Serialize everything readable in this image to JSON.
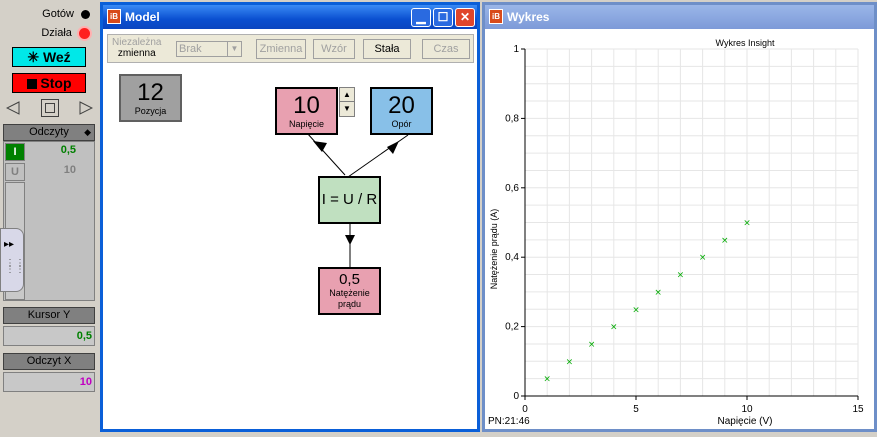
{
  "left_panel": {
    "ready_label": "Gotów",
    "working_label": "Działa",
    "take_label": "Weź",
    "stop_label": "Stop",
    "readings_header": "Odczyty",
    "readings": [
      {
        "tag": "I",
        "value": "0,5",
        "color": "#008000"
      },
      {
        "tag": "U",
        "value": "10",
        "color": "#808080"
      }
    ],
    "cursor_y_header": "Kursor Y",
    "cursor_y_value": "0,5",
    "reading_x_header": "Odczyt X",
    "reading_x_value": "10"
  },
  "model_window": {
    "title": "Model",
    "toolbar": {
      "independent_label_1": "Niezależna",
      "independent_label_2": "zmienna",
      "select_value": "Brak",
      "variable": "Zmienna",
      "formula": "Wzór",
      "constant": "Stała",
      "time": "Czas"
    },
    "nodes": {
      "position": {
        "value": "12",
        "label": "Pozycja"
      },
      "voltage": {
        "value": "10",
        "label": "Napięcie"
      },
      "resistance": {
        "value": "20",
        "label": "Opór"
      },
      "formula": {
        "value": "I = U / R"
      },
      "current": {
        "value": "0,5",
        "label1": "Natężenie",
        "label2": "prądu"
      }
    }
  },
  "chart_window": {
    "title": "Wykres",
    "status": "PN:21:46"
  },
  "chart_data": {
    "type": "scatter",
    "title": "Wykres Insight",
    "xlabel": "Napięcie (V)",
    "ylabel": "Natężenie prądu (A)",
    "xlim": [
      0,
      15
    ],
    "ylim": [
      0,
      1
    ],
    "xticks": [
      "0",
      "5",
      "10",
      "15"
    ],
    "yticks": [
      "0",
      "0,2",
      "0,4",
      "0,6",
      "0,8",
      "1"
    ],
    "grid": true,
    "marker_color": "#00aa00",
    "x": [
      1,
      2,
      3,
      4,
      5,
      6,
      7,
      8,
      9,
      10
    ],
    "y": [
      0.05,
      0.1,
      0.15,
      0.2,
      0.25,
      0.3,
      0.35,
      0.4,
      0.45,
      0.5
    ]
  }
}
